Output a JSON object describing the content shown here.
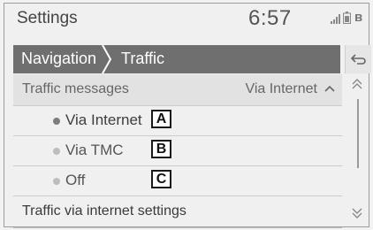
{
  "status": {
    "title": "Settings",
    "time": "6:57"
  },
  "breadcrumb": {
    "items": [
      "Navigation",
      "Traffic"
    ]
  },
  "traffic_messages": {
    "label": "Traffic messages",
    "value": "Via Internet"
  },
  "options": [
    {
      "label": "Via Internet",
      "callout": "A",
      "selected": true
    },
    {
      "label": "Via TMC",
      "callout": "B",
      "selected": false
    },
    {
      "label": "Off",
      "callout": "C",
      "selected": false
    }
  ],
  "internet_settings": {
    "label": "Traffic via internet settings"
  },
  "icons": {
    "signal": "signal-icon",
    "battery": "battery-icon",
    "bluetooth": "bluetooth-icon",
    "back": "back-icon",
    "scroll_up": "scroll-up-icon",
    "scroll_down": "scroll-down-icon",
    "collapse": "chevron-up-icon"
  }
}
